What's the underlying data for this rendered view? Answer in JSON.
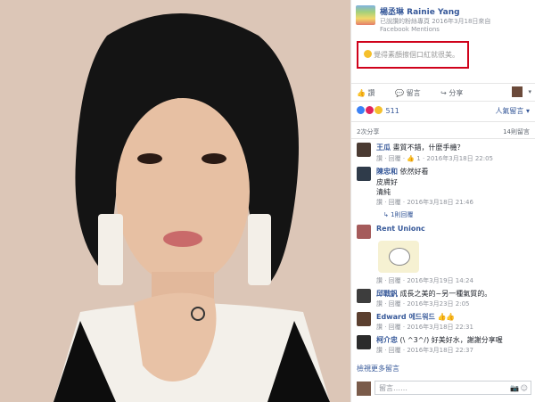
{
  "header": {
    "name": "楊丞琳 Rainie Yang",
    "subtitle": "已說讚的粉絲專頁  2016年3月18日來自",
    "source": "Facebook Mentions"
  },
  "post": {
    "text": "覺得素顏擦個口紅就很美。",
    "emoji_icon": "grin-emoji-icon"
  },
  "actions": {
    "like": "讚",
    "comment": "留言",
    "share": "分享"
  },
  "reactions": {
    "count": "511",
    "sort_label": "人氣留言 ▾"
  },
  "stats": {
    "shares": "2次分享",
    "comments_total": "14則留言"
  },
  "comments": [
    {
      "name": "王瓜",
      "text": "畫質不錯，什麼手機？",
      "meta": "讚 · 回覆 · 👍 1 · 2016年3月18日 22:05",
      "avatar_color": "#4a3a32"
    },
    {
      "name": "陳忠和",
      "text": "依然好看",
      "line2": "皮膚好",
      "line3": "清純",
      "meta": "讚 · 回覆 · 2016年3月18日 21:46",
      "replies": "↳ 1則回覆",
      "avatar_color": "#2f3b4a"
    },
    {
      "name": "Rent Unionc",
      "text": "",
      "meta": "讚 · 回覆 · 2016年3月19日 14:24",
      "avatar_color": "#a55b5b"
    },
    {
      "name": "邱戰釩",
      "text": "成長之美的~另一種氣質的。",
      "meta": "讚 · 回覆 · 2016年3月23日 2:05",
      "avatar_color": "#3d3d3d"
    },
    {
      "name": "Edward 에드워드",
      "text": "👍👍",
      "meta": "讚 · 回覆 · 2016年3月18日 22:31",
      "avatar_color": "#5b3f2f"
    },
    {
      "name": "柯介忠",
      "text": "(\\ ^3^/) 好美好水，謝謝分享喔",
      "meta": "讚 · 回覆 · 2016年3月18日 22:37",
      "avatar_color": "#2b2b2b"
    }
  ],
  "more_comments": "檢視更多留言",
  "input": {
    "placeholder": "留言……"
  },
  "colors": {
    "link": "#365899",
    "highlight_box": "#d0021b"
  }
}
